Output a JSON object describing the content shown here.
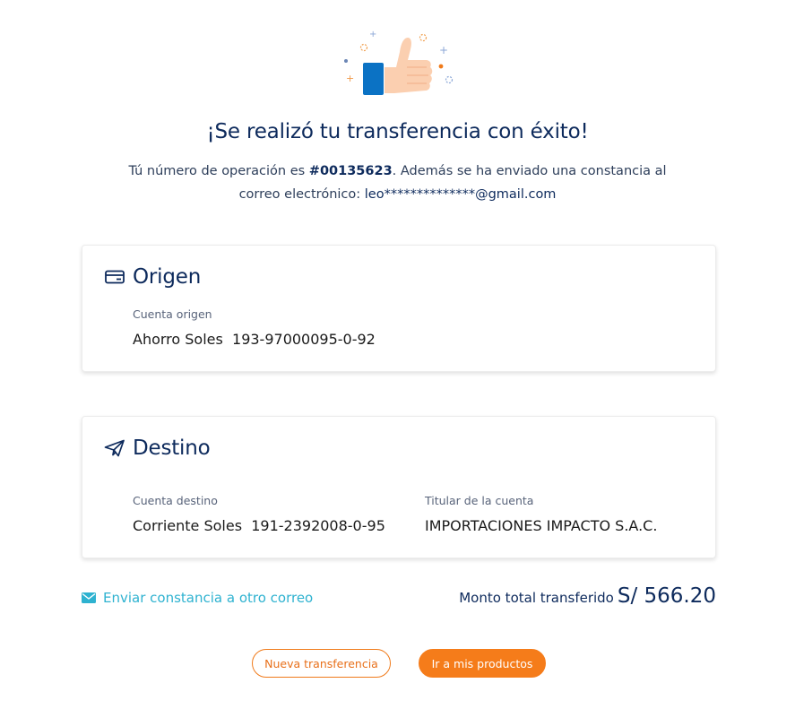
{
  "success": {
    "title": "¡Se realizó tu transferencia con éxito!",
    "line1_prefix": "Tú número de operación es ",
    "operation_number": "#00135623",
    "line1_suffix": ". Además se ha enviado una constancia al",
    "line2_prefix": "correo electrónico: ",
    "email": "leo**************@gmail.com"
  },
  "origin": {
    "title": "Origen",
    "account_label": "Cuenta origen",
    "account_value": "Ahorro Soles  193-97000095-0-92"
  },
  "destination": {
    "title": "Destino",
    "account_label": "Cuenta destino",
    "account_value": "Corriente Soles  191-2392008-0-95",
    "holder_label": "Titular de la cuenta",
    "holder_value": "IMPORTACIONES IMPACTO S.A.C."
  },
  "footer": {
    "send_link": "Enviar constancia a otro correo",
    "total_label": "Monto total transferido",
    "total_amount": "S/ 566.20"
  },
  "actions": {
    "new_transfer": "Nueva transferencia",
    "go_products": "Ir a mis productos"
  },
  "colors": {
    "primary": "#0d2a5c",
    "accent_orange": "#f57c1a",
    "link_cyan": "#2eb2d0",
    "thumb_blue": "#0b72c4"
  },
  "icons": {
    "hero": "thumbs-up-icon",
    "origin": "credit-card-icon",
    "destination": "paper-plane-icon",
    "send": "envelope-icon"
  }
}
